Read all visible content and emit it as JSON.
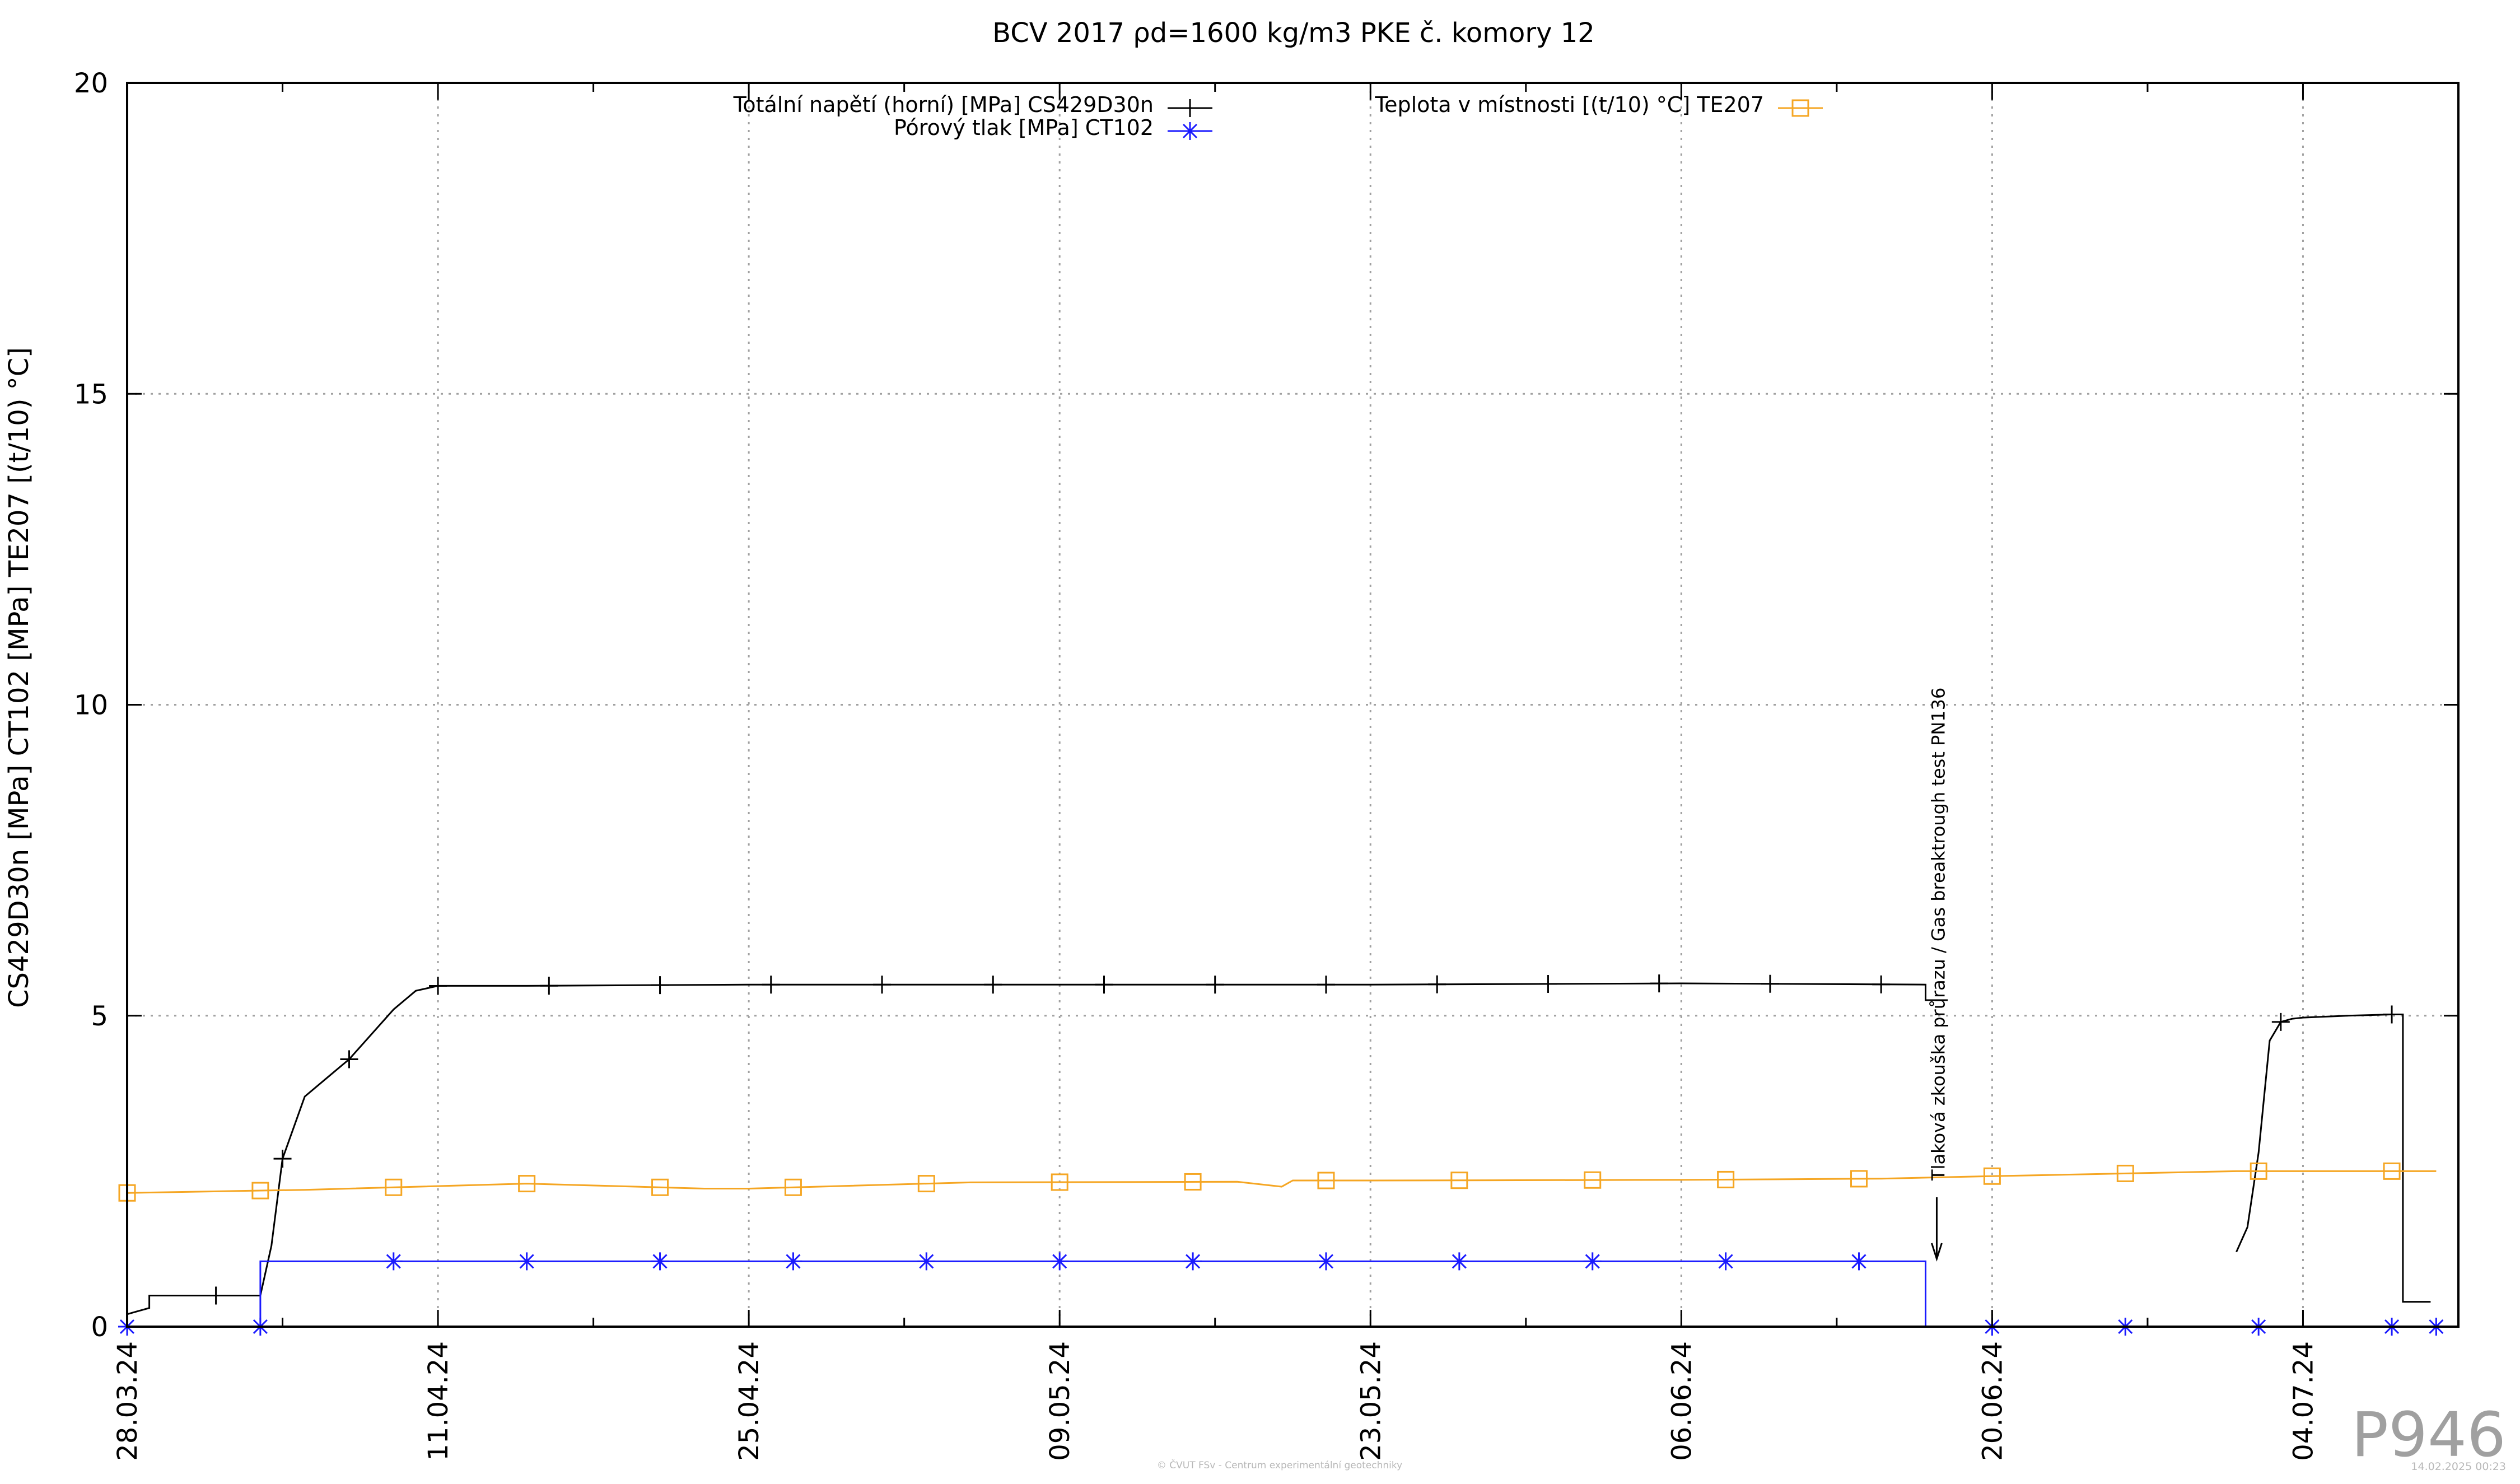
{
  "chart_data": {
    "type": "line",
    "title": "BCV 2017 ρd=1600 kg/m3 PKE č. komory 12",
    "ylabel": "CS429D30n [MPa] CT102 [MPa] TE207 [(t/10) °C]",
    "xlabel": "",
    "ylim": [
      0,
      20
    ],
    "xlim": [
      "2024-03-28",
      "2024-07-11"
    ],
    "y_ticks": [
      "0",
      "5",
      "10",
      "15",
      "20"
    ],
    "x_ticks": [
      "28.03.24",
      "11.04.24",
      "25.04.24",
      "09.05.24",
      "23.05.24",
      "06.06.24",
      "20.06.24",
      "04.07.24"
    ],
    "grid": true,
    "legend_position": "top",
    "series": [
      {
        "name": "Totální napětí (horní) [MPa] CS429D30n",
        "color": "#000000",
        "marker": "plus",
        "x": [
          "2024-03-28",
          "2024-03-28T12:00",
          "2024-03-29",
          "2024-03-29",
          "2024-04-03",
          "2024-04-03T12:00",
          "2024-04-04",
          "2024-04-05",
          "2024-04-06",
          "2024-04-07",
          "2024-04-08",
          "2024-04-09",
          "2024-04-10",
          "2024-04-11",
          "2024-04-15",
          "2024-04-25",
          "2024-05-09",
          "2024-05-23",
          "2024-06-06",
          "2024-06-17",
          "2024-06-17",
          "2024-06-18"
        ],
        "y": [
          0.2,
          0.25,
          0.3,
          0.5,
          0.5,
          1.3,
          2.7,
          3.7,
          4.0,
          4.3,
          4.7,
          5.1,
          5.4,
          5.48,
          5.48,
          5.5,
          5.5,
          5.5,
          5.52,
          5.5,
          5.25,
          5.25
        ],
        "segments": [
          {
            "x": [
              "2024-07-01",
              "2024-07-01T12:00",
              "2024-07-02",
              "2024-07-02T12:00",
              "2024-07-03",
              "2024-07-03T12:00",
              "2024-07-04",
              "2024-07-06",
              "2024-07-08",
              "2024-07-08T12:00",
              "2024-07-08T12:00",
              "2024-07-09T18:00"
            ],
            "y": [
              1.2,
              1.6,
              2.8,
              4.6,
              4.9,
              4.95,
              4.97,
              5.0,
              5.02,
              5.02,
              0.4,
              0.4
            ]
          }
        ]
      },
      {
        "name": "Pórový tlak [MPa] CT102",
        "color": "#1a1aff",
        "marker": "star",
        "x": [
          "2024-03-28",
          "2024-04-03",
          "2024-04-03",
          "2024-06-17",
          "2024-06-17",
          "2024-07-10"
        ],
        "y": [
          0.0,
          0.0,
          1.05,
          1.05,
          0.0,
          0.0
        ]
      },
      {
        "name": "Teplota v místnosti [(t/10) °C] TE207",
        "color": "#f5a623",
        "marker": "square",
        "x": [
          "2024-03-28",
          "2024-04-05",
          "2024-04-15",
          "2024-04-23",
          "2024-04-25",
          "2024-05-05",
          "2024-05-17",
          "2024-05-19",
          "2024-05-19T12:00",
          "2024-05-23",
          "2024-06-06",
          "2024-06-15",
          "2024-06-20",
          "2024-07-01",
          "2024-07-10"
        ],
        "y": [
          2.15,
          2.2,
          2.3,
          2.22,
          2.22,
          2.32,
          2.33,
          2.25,
          2.35,
          2.35,
          2.36,
          2.38,
          2.42,
          2.5,
          2.5
        ]
      }
    ],
    "annotations": [
      {
        "text": "Tlaková zkouška průrazu / Gas breaktrough test PN136",
        "x": "2024-06-17",
        "y": 1.0
      }
    ]
  },
  "watermark_id": "P946",
  "footer_text": "© ČVUT FSv - Centrum experimentální geotechniky",
  "timestamp": "14.02.2025 00:23"
}
